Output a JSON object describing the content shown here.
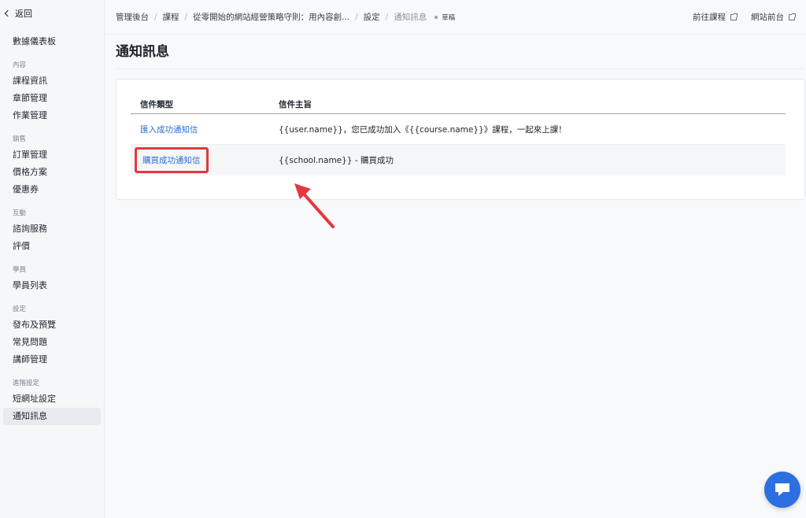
{
  "sidebar": {
    "back_label": "返回",
    "dashboard": "數據儀表板",
    "sections": [
      {
        "title": "內容",
        "items": [
          "課程資訊",
          "章節管理",
          "作業管理"
        ]
      },
      {
        "title": "銷售",
        "items": [
          "訂單管理",
          "價格方案",
          "優惠券"
        ]
      },
      {
        "title": "互動",
        "items": [
          "諮詢服務",
          "評價"
        ]
      },
      {
        "title": "學員",
        "items": [
          "學員列表"
        ]
      },
      {
        "title": "設定",
        "items": [
          "發布及預覽",
          "常見問題",
          "講師管理"
        ]
      },
      {
        "title": "進階設定",
        "items": [
          "短網址設定",
          "通知訊息"
        ]
      }
    ],
    "active_item": "通知訊息"
  },
  "breadcrumb": {
    "items": [
      "管理後台",
      "課程",
      "從零開始的網站經營策略守則：用內容創...",
      "設定",
      "通知訊息"
    ],
    "status": "草稿"
  },
  "top_links": {
    "course": "前往課程",
    "frontend": "網站前台"
  },
  "page": {
    "title": "通知訊息"
  },
  "table": {
    "headers": [
      "信件類型",
      "信件主旨"
    ],
    "rows": [
      {
        "type": "匯入成功通知信",
        "subject": "{{user.name}}，您已成功加入《{{course.name}}》課程，一起來上課！"
      },
      {
        "type": "購買成功通知信",
        "subject": "{{school.name}} - 購買成功"
      }
    ]
  },
  "colors": {
    "link": "#2f6fd6",
    "highlight": "#e53740",
    "chat": "#2b6fe3"
  },
  "icons": {
    "back": "chevron-left-icon",
    "external": "external-link-icon",
    "chat": "chat-bubble-icon",
    "annotation": "arrow-icon"
  }
}
